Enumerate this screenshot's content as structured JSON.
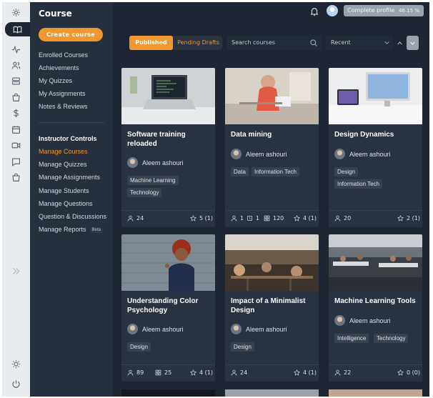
{
  "sidebar": {
    "title": "Course",
    "create_button": "Create course",
    "items": [
      "Enrolled Courses",
      "Achievements",
      "My Quizzes",
      "My Assignments",
      "Notes & Reviews"
    ],
    "instructor_heading": "Instructor Controls",
    "instructor_items": [
      "Manage Courses",
      "Manage Quizzes",
      "Manage Assignments",
      "Manage Students",
      "Manage Questions",
      "Question & Discussions",
      "Manage Reports"
    ],
    "beta_badge": "Beta"
  },
  "topbar": {
    "profile_label": "Complete profile",
    "profile_percent": "46.15 %",
    "profile_progress": 46.15
  },
  "filters": {
    "published": "Published",
    "drafts": "Pending Drafts",
    "search_placeholder": "Search courses",
    "sort": "Recent"
  },
  "icons": {
    "rail": [
      "gear-icon",
      "book-icon",
      "activity-icon",
      "users-icon",
      "layers-icon",
      "bag-icon",
      "dollar-icon",
      "calendar-icon",
      "video-icon",
      "message-icon",
      "bag-icon",
      "expand-icon",
      "sun-icon",
      "power-icon"
    ]
  },
  "colors": {
    "accent": "#f0982e",
    "background": "#1e2633",
    "card": "#293240",
    "sidebar": "#262f3c"
  },
  "courses": [
    {
      "title": "Software training reloaded",
      "author": "Aleem ashouri",
      "tags": [
        "Machine Learning",
        "Technology"
      ],
      "students": "24",
      "rating": "5 (1)"
    },
    {
      "title": "Data mining",
      "author": "Aleem ashouri",
      "tags": [
        "Data",
        "Information Tech"
      ],
      "students": "1",
      "quizzes": "1",
      "lessons": "120",
      "rating": "4 (1)"
    },
    {
      "title": "Design Dynamics",
      "author": "Aleem ashouri",
      "tags": [
        "Design",
        "Information Tech"
      ],
      "students": "20",
      "rating": "2 (1)"
    },
    {
      "title": "Understanding Color Psychology",
      "author": "Aleem ashouri",
      "tags": [
        "Design"
      ],
      "students": "89",
      "lessons": "25",
      "rating": "4 (1)"
    },
    {
      "title": "Impact of a Minimalist Design",
      "author": "Aleem ashouri",
      "tags": [
        "Design"
      ],
      "students": "24",
      "rating": "4 (1)"
    },
    {
      "title": "Machine Learning Tools",
      "author": "Aleem ashouri",
      "tags": [
        "Intelligence",
        "Technology"
      ],
      "students": "22",
      "rating": "0 (0)"
    }
  ]
}
